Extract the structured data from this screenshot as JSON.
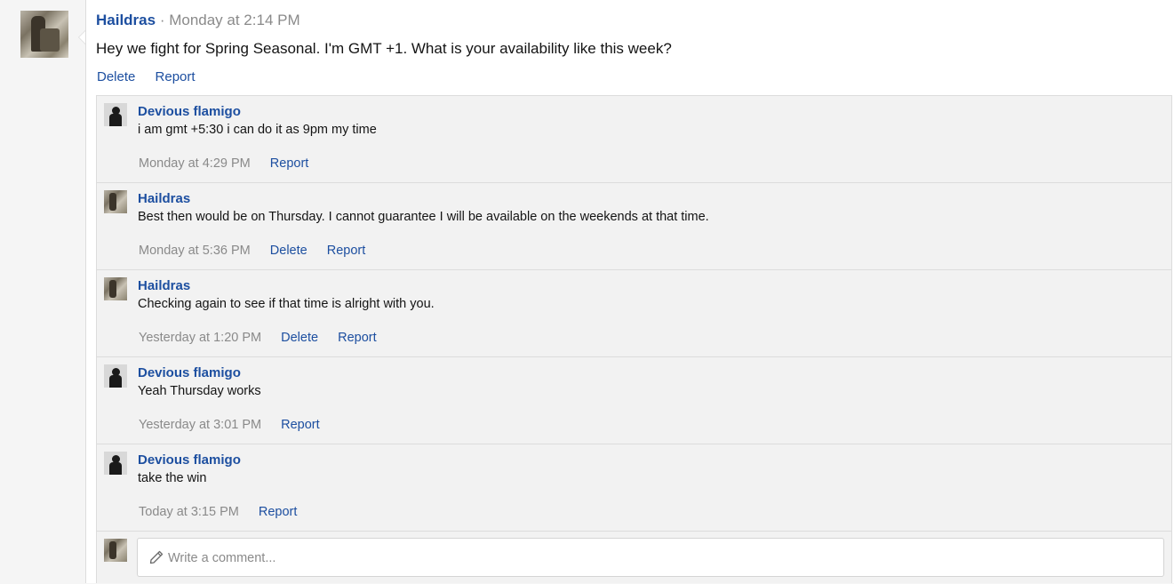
{
  "post": {
    "author": "Haildras",
    "separator": " · ",
    "time": "Monday at 2:14 PM",
    "body": "Hey we fight for Spring Seasonal. I'm GMT +1. What is your availability like this week?",
    "actions": {
      "delete": "Delete",
      "report": "Report"
    }
  },
  "comments": [
    {
      "author": "Devious flamigo",
      "body": "i am gmt +5:30 i can do it as 9pm my time",
      "time": "Monday at 4:29 PM",
      "report": "Report"
    },
    {
      "author": "Haildras",
      "body": "Best then would be on Thursday. I cannot guarantee I will be available on the weekends at that time.",
      "time": "Monday at 5:36 PM",
      "delete": "Delete",
      "report": "Report"
    },
    {
      "author": "Haildras",
      "body": "Checking again to see if that time is alright with you.",
      "time": "Yesterday at 1:20 PM",
      "delete": "Delete",
      "report": "Report"
    },
    {
      "author": "Devious flamigo",
      "body": "Yeah Thursday works",
      "time": "Yesterday at 3:01 PM",
      "report": "Report"
    },
    {
      "author": "Devious flamigo",
      "body": "take the win",
      "time": "Today at 3:15 PM",
      "report": "Report"
    }
  ],
  "composer": {
    "placeholder": "Write a comment..."
  },
  "icons": {
    "pencil": "pencil-icon"
  },
  "colors": {
    "link": "#1d4fa0",
    "muted": "#8a8a8a",
    "thread_bg": "#f2f2f2"
  }
}
